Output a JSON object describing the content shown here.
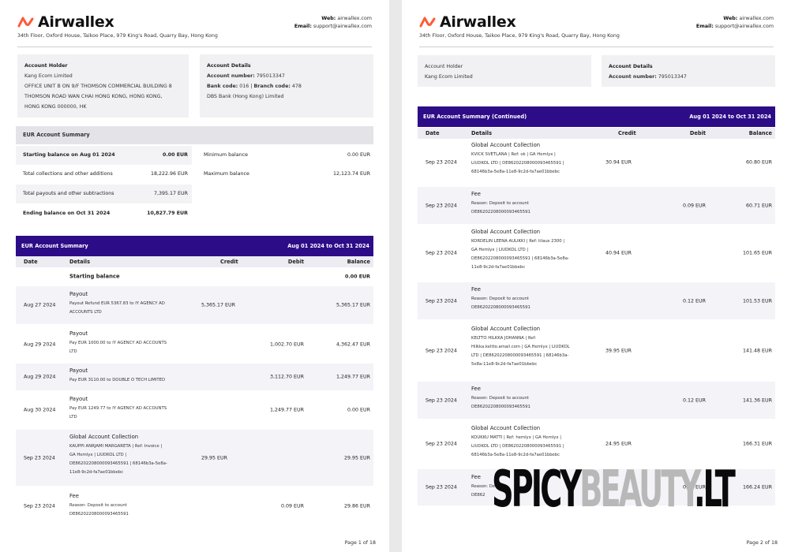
{
  "brand": {
    "name": "Airwallex",
    "accent": "#ff5a36",
    "primary": "#2d0c87"
  },
  "header": {
    "address": "34th Floor, Oxford House, Taikoo Place, 979 King's Road, Quarry Bay, Hong Kong",
    "web_label": "Web:",
    "web": "airwallex.com",
    "email_label": "Email:",
    "email": "support@airwallex.com"
  },
  "page1": {
    "holder": {
      "title": "Account Holder",
      "lines": [
        "Kang Ecom Limited",
        "OFFICE UNIT B ON 9/F THOMSON COMMERCIAL BUILDING 8",
        "THOMSON ROAD WAN CHAI HONG KONG, HONG KONG,",
        "HONG KONG 000000, HK"
      ]
    },
    "details": {
      "title": "Account Details",
      "account_label": "Account number:",
      "account": "795013347",
      "bank_label": "Bank code:",
      "bank": "016",
      "branch_label": "Branch code:",
      "branch": "478",
      "bank_name": "DBS Bank (Hong Kong) Limited"
    },
    "summary": {
      "title": "EUR Account Summary",
      "rows": [
        {
          "label": "Starting balance on Aug 01 2024",
          "value": "0.00 EUR"
        },
        {
          "label": "Total collections and other additions",
          "value": "18,222.96  EUR"
        },
        {
          "label": "Total payouts and other subtractions",
          "value": "7,395.17  EUR"
        },
        {
          "label": "Ending balance on Oct 31 2024",
          "value": "10,827.79 EUR"
        }
      ],
      "min_label": "Minimum balance",
      "min": "0.00 EUR",
      "max_label": "Maximum balance",
      "max": "12,123.74 EUR"
    },
    "table": {
      "title": "EUR Account Summary",
      "range": "Aug 01 2024 to Oct 31 2024",
      "columns": [
        "Date",
        "Details",
        "Credit",
        "Debit",
        "Balance"
      ],
      "rows": [
        {
          "date": "",
          "title": "Starting balance",
          "lines": [],
          "credit": "",
          "debit": "",
          "balance": "0.00 EUR"
        },
        {
          "date": "Aug 27 2024",
          "title": "Payout",
          "lines": [
            "Payout Refund EUR 5367.83 to IY AGENCY AD",
            "ACCOUNTS LTD"
          ],
          "credit": "5,365.17 EUR",
          "debit": "",
          "balance": "5,365.17 EUR"
        },
        {
          "date": "Aug 29 2024",
          "title": "Payout",
          "lines": [
            "Pay EUR 1000.00 to IY AGENCY AD ACCOUNTS",
            "LTD"
          ],
          "credit": "",
          "debit": "1,002.70 EUR",
          "balance": "4,362.47 EUR"
        },
        {
          "date": "Aug 29 2024",
          "title": "Payout",
          "lines": [
            "Pay EUR 3110.00 to DOUBLE O TECH LIMITED"
          ],
          "credit": "",
          "debit": "3,112.70 EUR",
          "balance": "1,249.77 EUR"
        },
        {
          "date": "Aug 30 2024",
          "title": "Payout",
          "lines": [
            "Pay EUR 1249.77 to IY AGENCY AD ACCOUNTS",
            "LTD"
          ],
          "credit": "",
          "debit": "1,249.77 EUR",
          "balance": "0.00 EUR"
        },
        {
          "date": "Sep 23 2024",
          "title": "Global Account Collection",
          "lines": [
            "KAUPPI ANRJAMI MARGARETA | Ref: Invoice |",
            "GA Hemlyx | LIUDKOL LTD |",
            "DE86202208000093465591 | 68146b3a-5e8a-",
            "11e8-9c2d-fa7ae01bbebc"
          ],
          "credit": "29.95 EUR",
          "debit": "",
          "balance": "29.95 EUR"
        },
        {
          "date": "Sep 23 2024",
          "title": "Fee",
          "lines": [
            "Reason: Deposit to account",
            "DE86202208000093465591"
          ],
          "credit": "",
          "debit": "0.09 EUR",
          "balance": "29.86 EUR"
        }
      ]
    },
    "page_num": "Page 1 of 18"
  },
  "page2": {
    "holder": {
      "title": "Account Holder",
      "name": "Kang Ecom Limited"
    },
    "details": {
      "title": "Account Details",
      "account_label": "Account number:",
      "account": "795013347"
    },
    "table": {
      "title": "EUR Account Summary (Continued)",
      "range": "Aug 01 2024 to Oct 31 2024",
      "columns": [
        "Date",
        "Details",
        "Credit",
        "Debit",
        "Balance"
      ],
      "rows": [
        {
          "date": "Sep 23 2024",
          "title": "Global Account Collection",
          "lines": [
            "KVICK SVETLANA | Ref: ok | GA Hemlyx |",
            "LIUDKOL LTD | DE86202208000093465591 |",
            "68146b3a-5e8a-11e8-9c2d-fa7ae01bbebc"
          ],
          "credit": "30.94 EUR",
          "debit": "",
          "balance": "60.80 EUR"
        },
        {
          "date": "Sep 23 2024",
          "title": "Fee",
          "lines": [
            "Reason: Deposit to account",
            "DE86202208000093465591"
          ],
          "credit": "",
          "debit": "0.09 EUR",
          "balance": "60.71 EUR"
        },
        {
          "date": "Sep 23 2024",
          "title": "Global Account Collection",
          "lines": [
            "KORDELIN LEENA AULIKKI | Ref: tilaus 2300 |",
            "GA Hemlyx | LIUDKOL LTD |",
            "DE86202208000093465591 | 68146b3a-5e8a-",
            "11e8-9c2d-fa7ae01bbebc"
          ],
          "credit": "40.94 EUR",
          "debit": "",
          "balance": "101.65 EUR"
        },
        {
          "date": "Sep 23 2024",
          "title": "Fee",
          "lines": [
            "Reason: Deposit to account",
            "DE86202208000093465591"
          ],
          "credit": "",
          "debit": "0.12 EUR",
          "balance": "101.53 EUR"
        },
        {
          "date": "Sep 23 2024",
          "title": "Global Account Collection",
          "lines": [
            "KELTTO HILKKA JOHANNA | Ref:",
            "Hilkka.keltto.amail.com | GA Hemlyx | LIUDKOL",
            "LTD | DE86202208000093465591 | 68146b3a-",
            "5e8a-11e8-9c2d-fa7ae01bbebc"
          ],
          "credit": "39.95 EUR",
          "debit": "",
          "balance": "141.48 EUR"
        },
        {
          "date": "Sep 23 2024",
          "title": "Fee",
          "lines": [
            "Reason: Deposit to account",
            "DE86202208000093465591"
          ],
          "credit": "",
          "debit": "0.12 EUR",
          "balance": "141.36 EUR"
        },
        {
          "date": "Sep 23 2024",
          "title": "Global Account Collection",
          "lines": [
            "KOUKKU MATTI | Ref: hemlyx | GA Hemlyx |",
            "LIUDKOL LTD | DE86202208000093465591 |",
            "68146b3a-5e8a-11e8-9c2d-fa7ae01bbebc"
          ],
          "credit": "24.95 EUR",
          "debit": "",
          "balance": "166.31 EUR"
        },
        {
          "date": "Sep 23 2024",
          "title": "Fee",
          "lines": [
            "Reason: De",
            "DE862"
          ],
          "credit": "",
          "debit": "0.07 EUR",
          "balance": "166.24 EUR"
        }
      ]
    },
    "page_num": "Page 2 of 18"
  },
  "watermark": {
    "dark": "SPICY",
    "light": "BEAUTY",
    "dark2": ".LT"
  }
}
